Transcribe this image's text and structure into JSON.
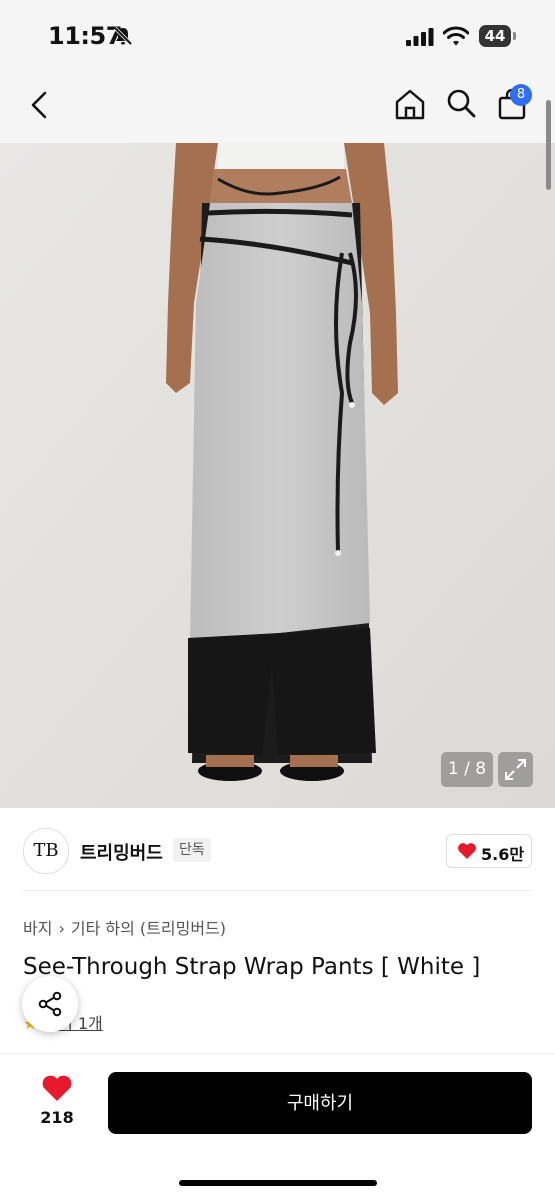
{
  "status_bar": {
    "time": "11:57",
    "battery": "44"
  },
  "nav": {
    "cart_badge": "8"
  },
  "gallery": {
    "counter": "1 / 8"
  },
  "brand": {
    "logo_text": "TB",
    "name": "트리밍버드",
    "badge": "단독",
    "likes": "5.6만"
  },
  "product": {
    "breadcrumb": [
      "바지",
      "기타 하의 (트리밍버드)"
    ],
    "title": "See-Through Strap Wrap Pants [ White ]",
    "review_link": "후기 1개"
  },
  "bottom_bar": {
    "wish_count": "218",
    "buy_label": "구매하기"
  },
  "colors": {
    "accent_blue": "#2f6df2",
    "heart_red": "#e8192c",
    "buy_bg": "#000000"
  }
}
